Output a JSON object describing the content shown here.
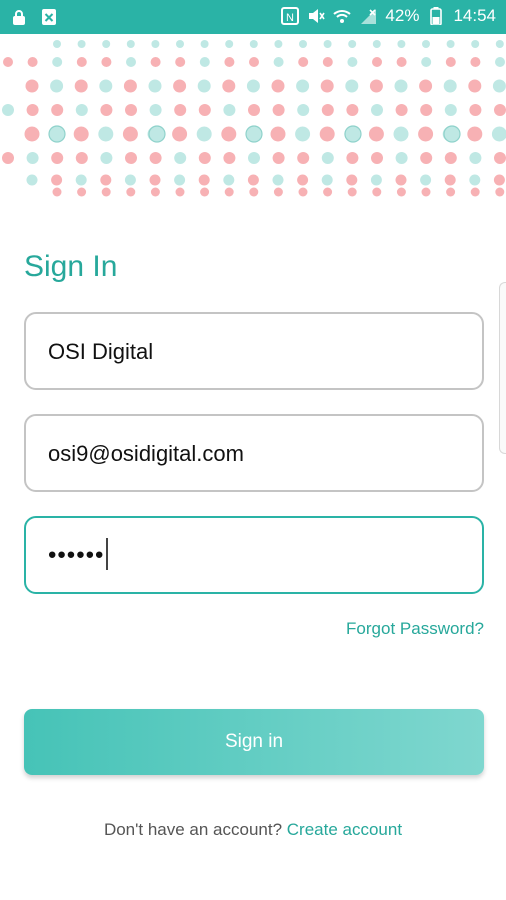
{
  "status_bar": {
    "battery_percent": "42%",
    "time": "14:54",
    "icons": [
      "lock-icon",
      "close-box-icon",
      "nfc-icon",
      "mute-icon",
      "wifi-icon",
      "no-signal-icon",
      "battery-icon"
    ]
  },
  "colors": {
    "status_bar": "#2ab3a6",
    "accent": "#27a89b",
    "dot_pink": "#f7b1b4",
    "dot_teal": "#bfe8e4"
  },
  "form": {
    "title": "Sign In",
    "company_value": "OSI Digital",
    "email_value": "osi9@osidigital.com",
    "password_mask": "••••••",
    "forgot_label": "Forgot Password?",
    "submit_label": "Sign in"
  },
  "footer": {
    "prompt": "Don't have an account?",
    "link": "Create account"
  }
}
